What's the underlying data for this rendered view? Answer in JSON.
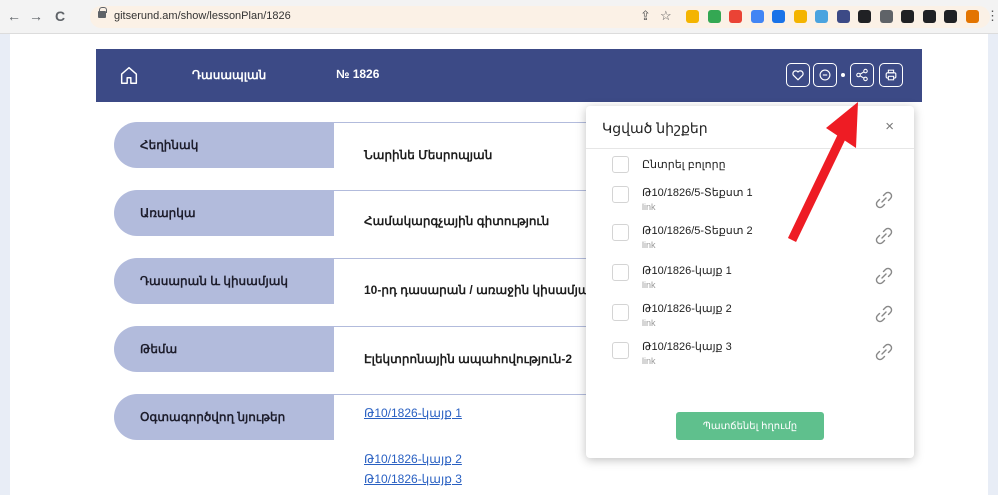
{
  "browser": {
    "back": "←",
    "forward": "→",
    "reload": "C",
    "url": "gitserund.am/show/lessonPlan/1826",
    "ext_colors": [
      "#f4b400",
      "#34a853",
      "#ea4335",
      "#4285f4",
      "#1a73e8",
      "#f4b400",
      "#4aa3df",
      "#3c4a86",
      "#202124",
      "#5f6368",
      "#202124",
      "#202124",
      "#202124",
      "#e37400"
    ]
  },
  "header": {
    "title": "Դասապլան",
    "number": "№ 1826"
  },
  "info": [
    {
      "label": "Հեղինակ",
      "value": "Նարինե Մեսրոպյան"
    },
    {
      "label": "Առարկա",
      "value": "Համակարգչային գիտություն"
    },
    {
      "label": "Դասարան և կիսամյակ",
      "value": "10-րդ դասարան / առաջին կիսամյակ"
    },
    {
      "label": "Թեմա",
      "value": "Էլեկտրոնային ապահովություն-2"
    },
    {
      "label": "Օգտագործվող նյութեր",
      "links": [
        "Թ10/1826-կայք 1",
        "Թ10/1826-կայք 2",
        "Թ10/1826-կայք 3"
      ]
    }
  ],
  "popup": {
    "title": "Կցված նիշքեր",
    "close": "×",
    "select_all": "Ընտրել բոլորը",
    "items": [
      {
        "title": "Թ10/1826/5-Տեքստ 1",
        "type": "link"
      },
      {
        "title": "Թ10/1826/5-Տեքստ 2",
        "type": "link"
      },
      {
        "title": "Թ10/1826-կայք 1",
        "type": "link"
      },
      {
        "title": "Թ10/1826-կայք 2",
        "type": "link"
      },
      {
        "title": "Թ10/1826-կայք 3",
        "type": "link"
      }
    ],
    "save_label": "Պատճենել հղումը"
  }
}
